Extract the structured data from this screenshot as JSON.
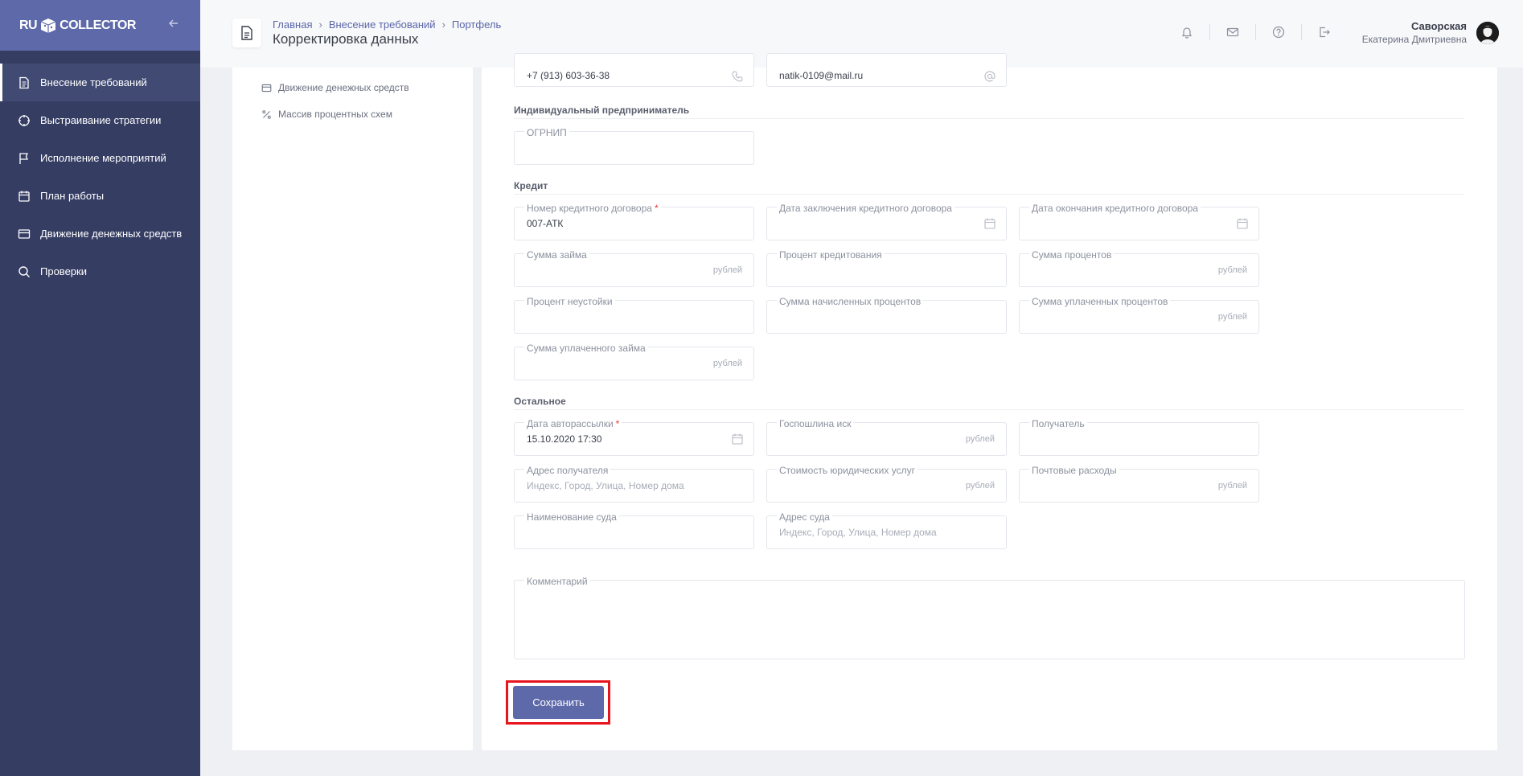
{
  "app": {
    "logo_left": "RU",
    "logo_right": "COLLECTOR"
  },
  "sidebar": {
    "items": [
      {
        "label": "Внесение требований",
        "icon": "document-icon",
        "active": true
      },
      {
        "label": "Выстраивание стратегии",
        "icon": "crosshair-icon",
        "active": false
      },
      {
        "label": "Исполнение мероприятий",
        "icon": "flag-icon",
        "active": false
      },
      {
        "label": "План работы",
        "icon": "calendar-icon",
        "active": false
      },
      {
        "label": "Движение денежных средств",
        "icon": "credit-card-icon",
        "active": false
      },
      {
        "label": "Проверки",
        "icon": "search-icon",
        "active": false
      }
    ]
  },
  "header": {
    "breadcrumb": [
      "Главная",
      "Внесение требований",
      "Портфель"
    ],
    "title": "Корректировка данных",
    "user": {
      "last_name": "Саворская",
      "first_name": "Екатерина Дмитриевна"
    }
  },
  "left_panel": {
    "links": [
      {
        "label": "Движение денежных средств",
        "icon": "credit-card-icon"
      },
      {
        "label": "Массив процентных схем",
        "icon": "percent-icon"
      }
    ]
  },
  "contacts": {
    "phone": "+7 (913) 603-36-38",
    "email": "natik-0109@mail.ru"
  },
  "sections": {
    "ip": "Индивидуальный предприниматель",
    "credit": "Кредит",
    "other": "Остальное"
  },
  "fields": {
    "ogrnip": {
      "label": "ОГРНИП",
      "value": ""
    },
    "contract_number": {
      "label": "Номер кредитного договора",
      "value": "007-АТК",
      "required": "*"
    },
    "contract_date": {
      "label": "Дата заключения кредитного договора"
    },
    "contract_end": {
      "label": "Дата окончания кредитного договора"
    },
    "loan_sum": {
      "label": "Сумма займа",
      "suffix": "рублей"
    },
    "interest_rate": {
      "label": "Процент кредитования"
    },
    "interest_sum": {
      "label": "Сумма процентов",
      "suffix": "рублей"
    },
    "penalty_rate": {
      "label": "Процент неустойки"
    },
    "accrued_interest": {
      "label": "Сумма начисленных процентов"
    },
    "paid_interest": {
      "label": "Сумма уплаченных процентов",
      "suffix": "рублей"
    },
    "paid_loan": {
      "label": "Сумма уплаченного займа",
      "suffix": "рублей"
    },
    "auto_mail_date": {
      "label": "Дата авторассылки",
      "value": "15.10.2020 17:30",
      "required": "*"
    },
    "state_fee": {
      "label": "Госпошлина иск",
      "suffix": "рублей"
    },
    "recipient": {
      "label": "Получатель"
    },
    "recipient_address": {
      "label": "Адрес получателя",
      "placeholder": "Индекс, Город, Улица, Номер дома"
    },
    "legal_cost": {
      "label": "Стоимость юридических услуг",
      "suffix": "рублей"
    },
    "postal_cost": {
      "label": "Почтовые расходы",
      "suffix": "рублей"
    },
    "court_name": {
      "label": "Наименование суда"
    },
    "court_address": {
      "label": "Адрес суда",
      "placeholder": "Индекс, Город, Улица, Номер дома"
    },
    "comment": {
      "label": "Комментарий"
    }
  },
  "actions": {
    "save": "Сохранить"
  },
  "colors": {
    "sidebar": "#353d63",
    "accent": "#5d69a8",
    "highlight": "#e8141c"
  }
}
